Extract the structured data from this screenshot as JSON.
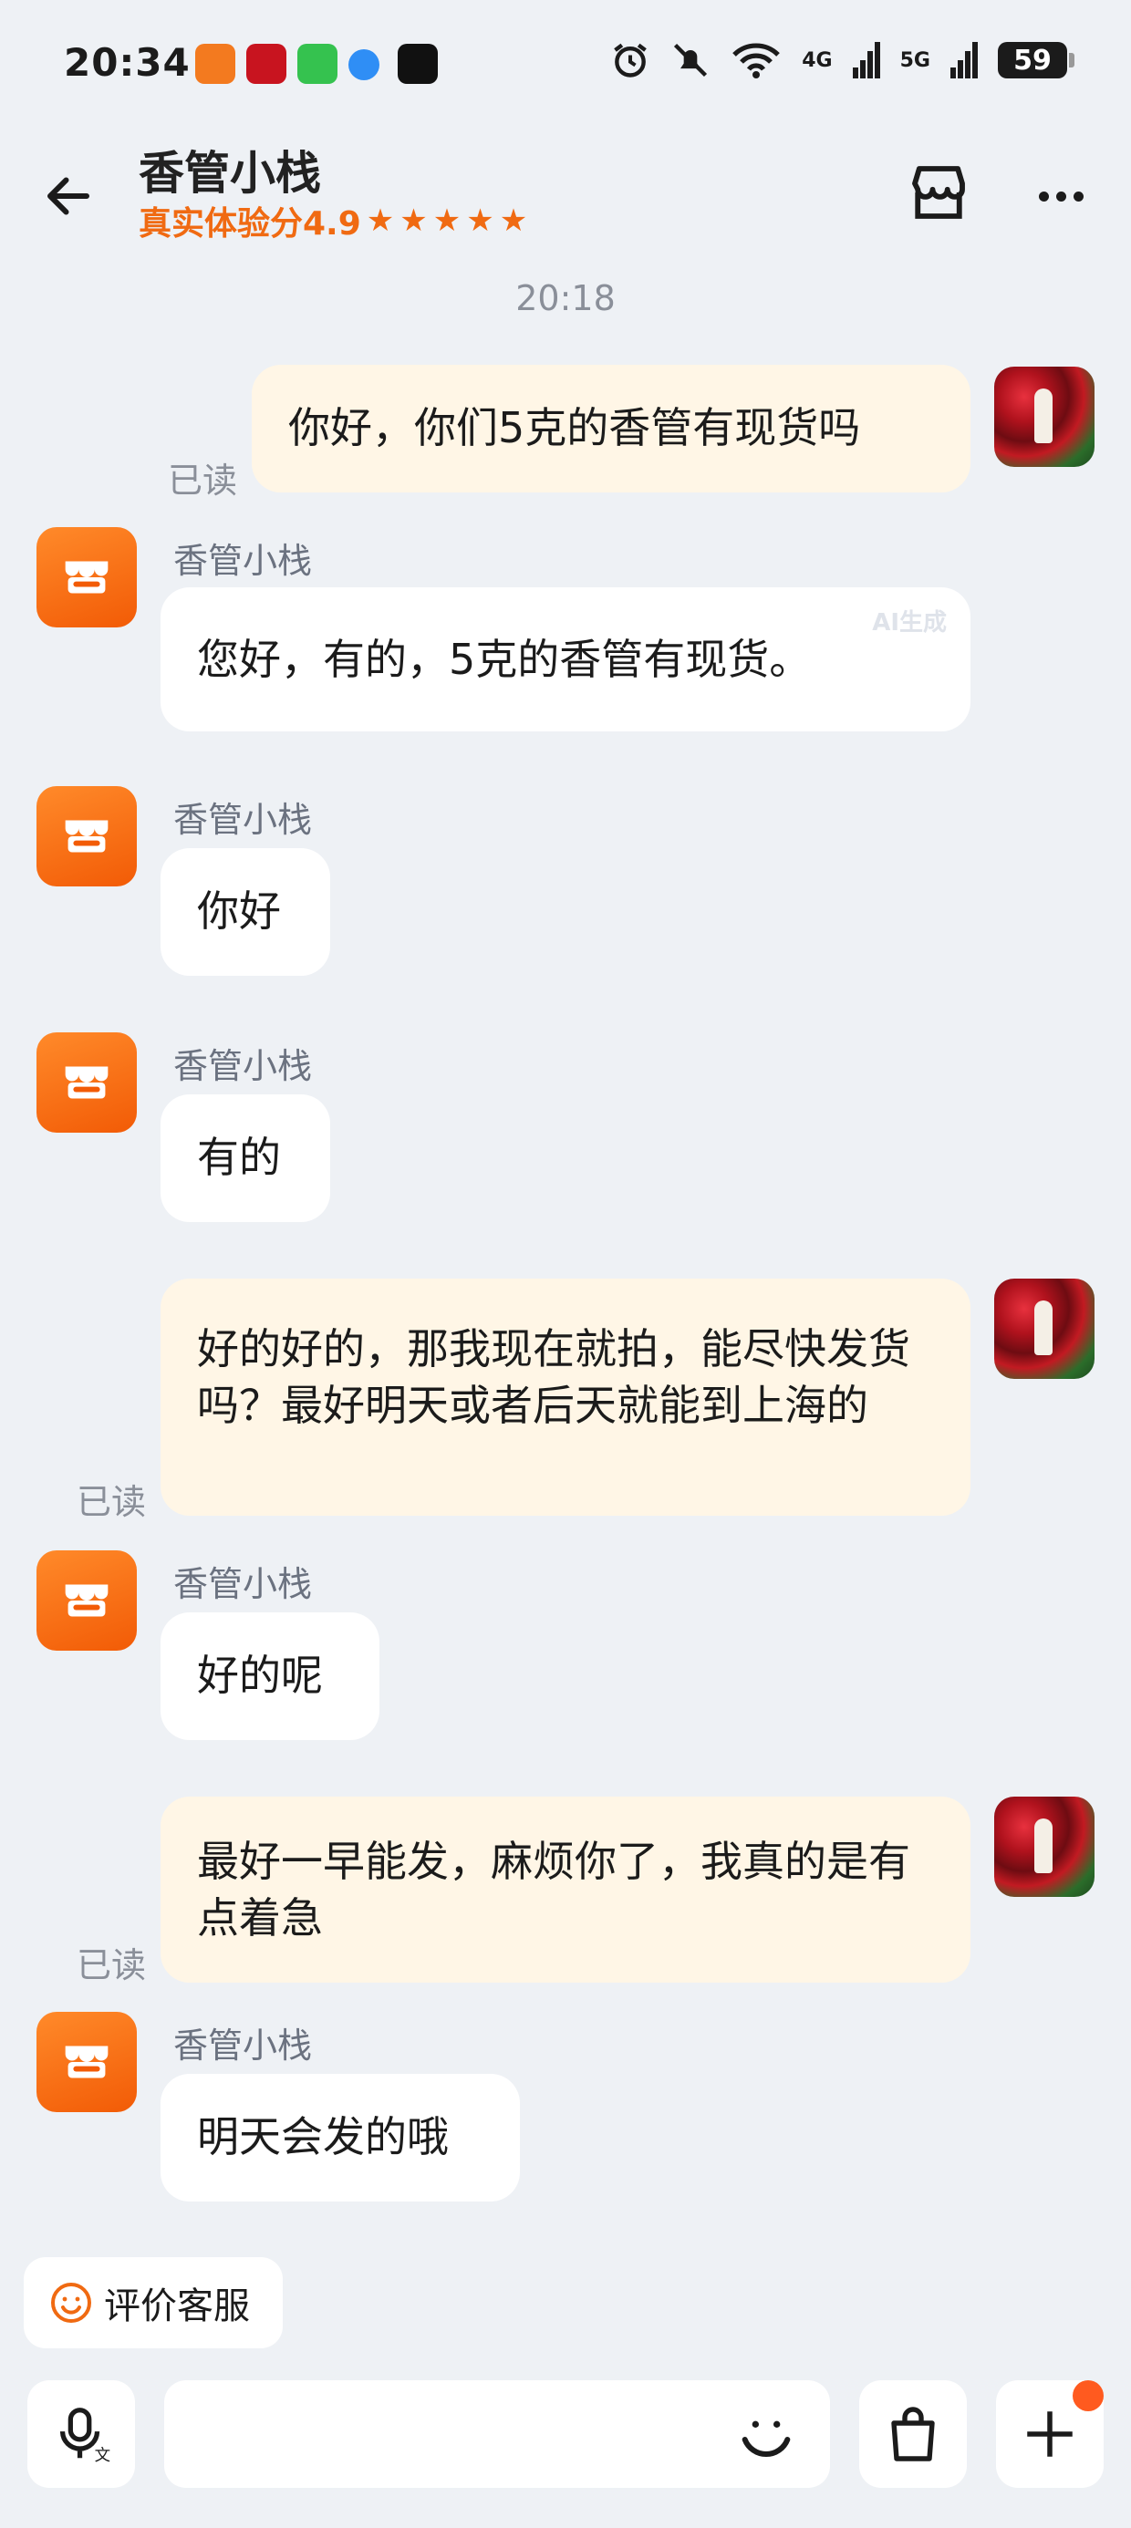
{
  "status_bar": {
    "time": "20:34",
    "signal_a": "4G",
    "signal_b": "5G",
    "battery": "59"
  },
  "header": {
    "shop_name": "香管小栈",
    "score_label": "真实体验分4.9",
    "stars": 5
  },
  "chat": {
    "time_divider": "20:18",
    "read_label": "已读",
    "sender_name": "香管小栈",
    "ai_mark": "AI生成",
    "messages": [
      {
        "from": "me",
        "text": "你好，你们5克的香管有现货吗"
      },
      {
        "from": "shop",
        "text": "您好，有的，5克的香管有现货。"
      },
      {
        "from": "shop",
        "text": "你好"
      },
      {
        "from": "shop",
        "text": "有的"
      },
      {
        "from": "me",
        "text": "好的好的，那我现在就拍，能尽快发货吗？最好明天或者后天就能到上海的"
      },
      {
        "from": "shop",
        "text": "好的呢"
      },
      {
        "from": "me",
        "text": "最好一早能发，麻烦你了，我真的是有点着急"
      },
      {
        "from": "shop",
        "text": "明天会发的哦"
      }
    ]
  },
  "footer": {
    "rate_label": "评价客服",
    "input_placeholder": ""
  },
  "colors": {
    "accent": "#f06a12",
    "my_bubble": "#fff6e6",
    "background": "#eef1f5"
  }
}
